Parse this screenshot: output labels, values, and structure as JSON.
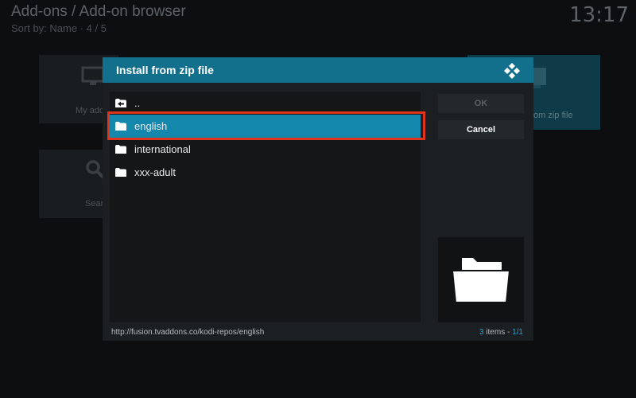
{
  "background": {
    "title": "Add-ons / Add-on browser",
    "subtitle": "Sort by: Name  ·  4 / 5",
    "clock": "13:17",
    "tiles": {
      "my_addons_label": "My add",
      "search_label": "Sear",
      "zip_label": "om zip file"
    }
  },
  "dialog": {
    "title": "Install from zip file",
    "items": [
      {
        "label": "..",
        "icon": "folder-up-icon"
      },
      {
        "label": "english",
        "icon": "folder-icon",
        "focused": true
      },
      {
        "label": "international",
        "icon": "folder-icon"
      },
      {
        "label": "xxx-adult",
        "icon": "folder-icon"
      }
    ],
    "ok_label": "OK",
    "cancel_label": "Cancel",
    "path": "http://fusion.tvaddons.co/kodi-repos/english",
    "count_number": "3",
    "count_items": " items - ",
    "count_page": "1/1"
  },
  "colors": {
    "header": "#12708d",
    "focus": "#1487ac",
    "annotation": "#e0341c",
    "accent_text": "#19a6d8"
  }
}
